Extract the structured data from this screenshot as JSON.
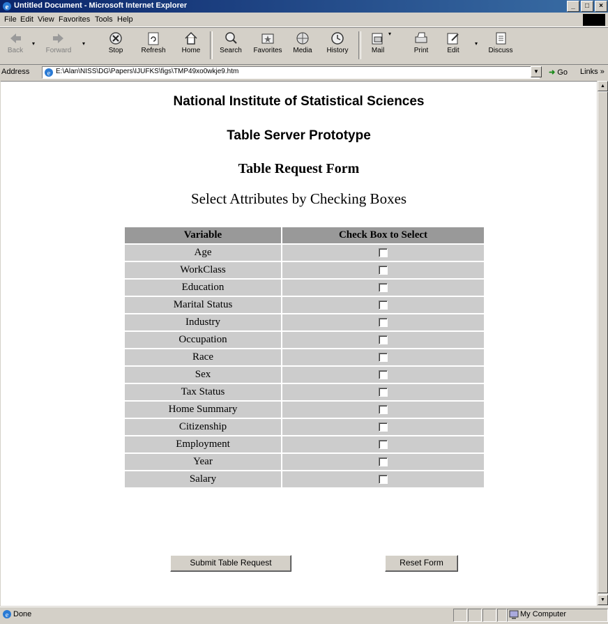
{
  "window": {
    "title": "Untitled Document - Microsoft Internet Explorer",
    "minimize": "_",
    "maximize": "□",
    "close": "×"
  },
  "menu": [
    "File",
    "Edit",
    "View",
    "Favorites",
    "Tools",
    "Help"
  ],
  "toolbar": {
    "back": "Back",
    "forward": "Forward",
    "stop": "Stop",
    "refresh": "Refresh",
    "home": "Home",
    "search": "Search",
    "favorites": "Favorites",
    "media": "Media",
    "history": "History",
    "mail": "Mail",
    "print": "Print",
    "edit": "Edit",
    "discuss": "Discuss"
  },
  "address": {
    "label": "Address",
    "url": "E:\\Alan\\NISS\\DG\\Papers\\IJUFKS\\figs\\TMP49xo0wkje9.htm",
    "go": "Go",
    "links": "Links »"
  },
  "page": {
    "heading1": "National Institute of Statistical Sciences",
    "heading2": "Table Server Prototype",
    "heading3": "Table Request Form",
    "heading4": "Select Attributes by Checking Boxes",
    "table": {
      "col1": "Variable",
      "col2": "Check Box to Select",
      "rows": [
        "Age",
        "WorkClass",
        "Education",
        "Marital Status",
        "Industry",
        "Occupation",
        "Race",
        "Sex",
        "Tax Status",
        "Home Summary",
        "Citizenship",
        "Employment",
        "Year",
        "Salary"
      ]
    },
    "submit": "Submit Table Request",
    "reset": "Reset Form"
  },
  "status": {
    "text": "Done",
    "zone": "My Computer"
  }
}
